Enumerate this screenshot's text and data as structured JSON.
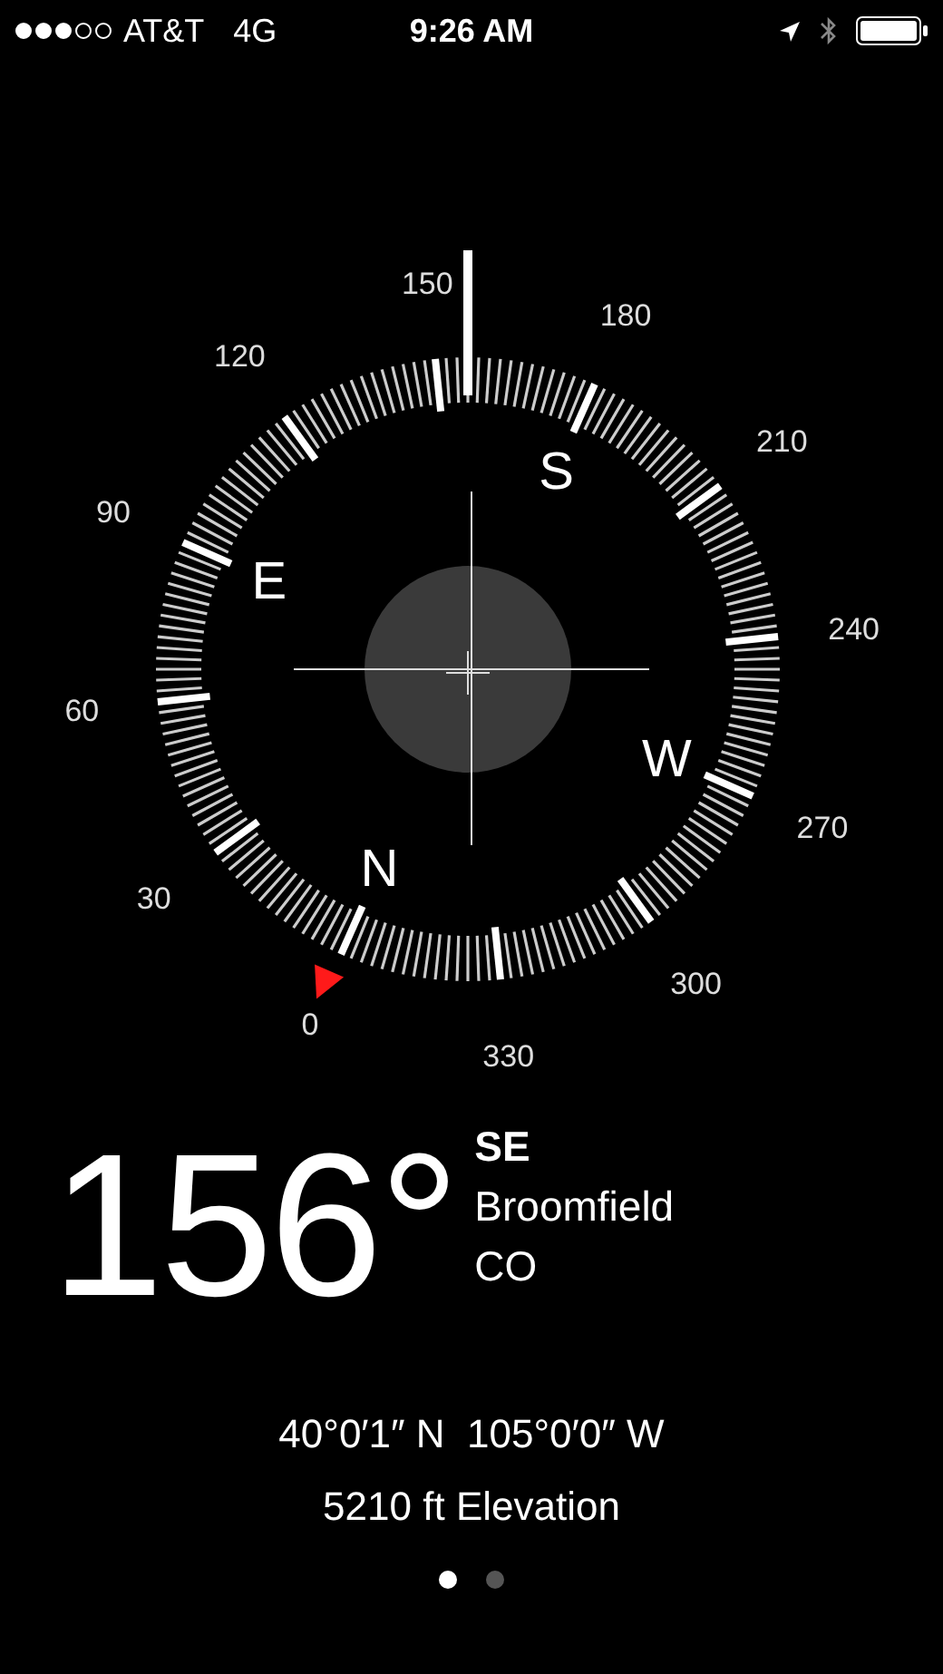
{
  "status_bar": {
    "carrier": "AT&T",
    "network": "4G",
    "time": "9:26 AM"
  },
  "dial": {
    "degree_labels": [
      "0",
      "30",
      "60",
      "90",
      "120",
      "150",
      "180",
      "210",
      "240",
      "270",
      "300",
      "330"
    ],
    "cardinals": [
      "N",
      "E",
      "S",
      "W"
    ]
  },
  "reading": {
    "heading": "156°",
    "direction": "SE",
    "city": "Broomfield",
    "region": "CO"
  },
  "coordinates": "40°0′1″ N  105°0′0″ W",
  "elevation": "5210 ft Elevation",
  "page_dots": [
    {
      "selected": true
    },
    {
      "selected": false
    }
  ]
}
